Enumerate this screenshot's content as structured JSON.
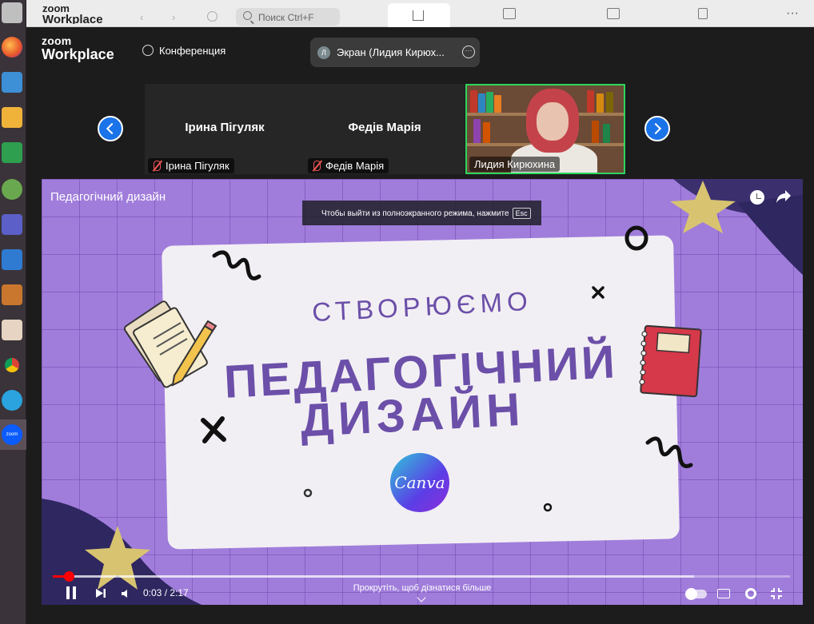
{
  "outer_app": {
    "logo_top": "zoom",
    "logo_bottom": "Workplace",
    "search_placeholder": "Поиск Ctrl+F"
  },
  "header": {
    "logo_top": "zoom",
    "logo_bottom": "Workplace",
    "conference_label": "Конференция",
    "share_avatar": "Л",
    "share_label": "Экран (Лидия Кирюх..."
  },
  "participants": [
    {
      "big_name": "Ірина Пігуляк",
      "tag": "Ірина Пігуляк",
      "muted": true
    },
    {
      "big_name": "Федів Марія",
      "tag": "Федів Марія",
      "muted": true
    },
    {
      "tag": "Лидия Кирюхина",
      "video": true,
      "active_speaker": true
    }
  ],
  "video": {
    "title": "Педагогічний дизайн",
    "esc_notice": "Чтобы выйти из полноэкранного режима, нажмите",
    "esc_key": "Esc",
    "slide_line1": "СТВОРЮЄМО",
    "slide_line2": "ПЕДАГОГІЧНИЙ",
    "slide_line3": "ДИЗАЙН",
    "canva_logo": "Canva",
    "time": "0:03 / 2:17",
    "progress_fraction": 0.022,
    "buffered_fraction": 0.87,
    "scroll_hint": "Прокрутіть, щоб дізнатися більше"
  },
  "colors": {
    "active_speaker_border": "#2dd65d",
    "nav_arrow": "#1a73e8",
    "progress": "#ff0000",
    "slide_text": "#6b4fa8"
  }
}
